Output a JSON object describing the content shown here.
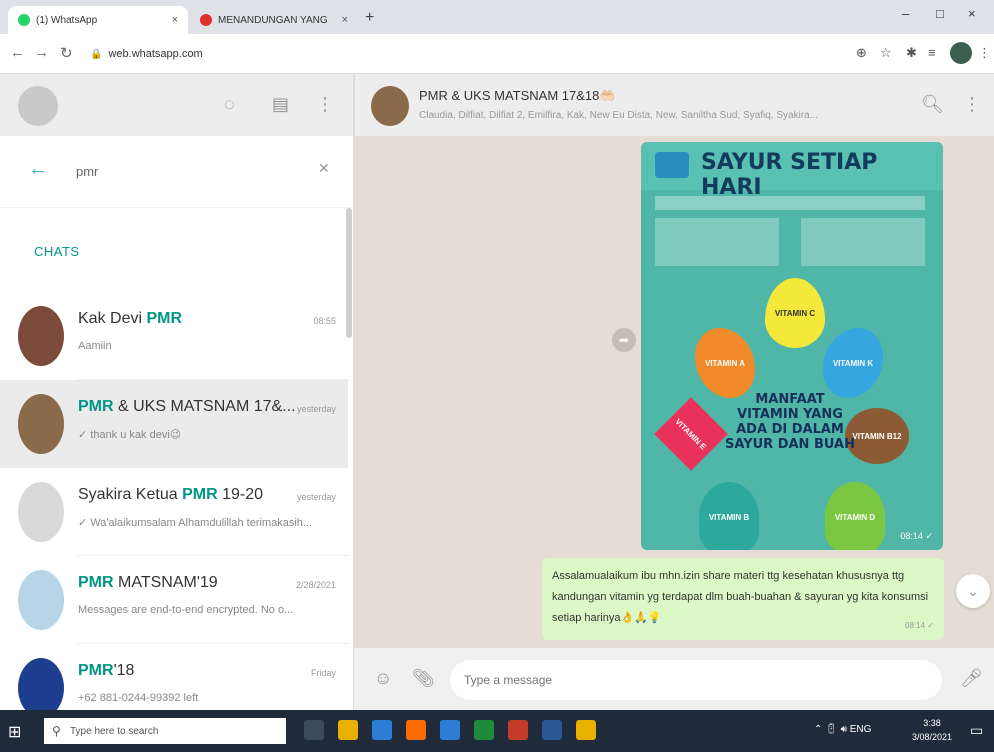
{
  "browser": {
    "tabs": [
      {
        "title": "(1) WhatsApp",
        "favicon_color": "#25d366",
        "active": true
      },
      {
        "title": "MENANDUNGAN YANG",
        "favicon_color": "#e0302a",
        "active": false
      }
    ],
    "url": "web.whatsapp.com",
    "window_controls": [
      "–",
      "□",
      "×"
    ]
  },
  "sidebar": {
    "search_value": "pmr",
    "section_label": "CHATS",
    "chats": [
      {
        "name_prefix": "Kak Devi ",
        "name_highlight": "PMR",
        "name_suffix": "",
        "time": "08:55",
        "message": "Aamiin",
        "avatar_color": "#7b4a3a",
        "selected": false
      },
      {
        "name_prefix": "",
        "name_highlight": "PMR",
        "name_suffix": " & UKS MATSNAM 17&...",
        "time": "yesterday",
        "message": "✓ thank u kak devi😉",
        "avatar_color": "#8a6a4a",
        "selected": true
      },
      {
        "name_prefix": "Syakira Ketua ",
        "name_highlight": "PMR",
        "name_suffix": " 19-20",
        "time": "yesterday",
        "message": "✓ Wa'alaikumsalam Alhamdulillah terimakasih...",
        "avatar_color": "#d9d9d9",
        "selected": false
      },
      {
        "name_prefix": "",
        "name_highlight": "PMR",
        "name_suffix": " MATSNAM'19",
        "time": "2/28/2021",
        "message": "Messages are end-to-end encrypted. No o...",
        "avatar_color": "#b8d4e8",
        "selected": false
      },
      {
        "name_prefix": "",
        "name_highlight": "PMR",
        "name_suffix": "'18",
        "time": "Friday",
        "message": "+62 881-0244-99392 left",
        "avatar_color": "#1e3f8f",
        "selected": false
      }
    ]
  },
  "conversation": {
    "title": "PMR & UKS MATSNAM 17&18🤲🏻",
    "members": "Claudia, Dilfiat, Dilfiat 2, Emilfira, Kak, New Eu Dista, New, Saniltha Sud, Syafiq, Syakira...",
    "image_message": {
      "title": "SAYUR SETIAP HARI",
      "center_text": "MANFAAT VITAMIN YANG ADA DI DALAM SAYUR DAN BUAH",
      "petals": [
        "VITAMIN C",
        "VITAMIN A",
        "VITAMIN K",
        "VITAMIN E",
        "VITAMIN B12",
        "VITAMIN B",
        "VITAMIN D"
      ],
      "time": "08:14 ✓"
    },
    "text_message": {
      "text": "Assalamualaikum ibu mhn.izin share materi ttg kesehatan khususnya ttg kandungan vitamin yg terdapat dlm buah-buahan & sayuran yg kita konsumsi setiap harinya👌🙏💡",
      "time": "08:14 ✓"
    },
    "composer_placeholder": "Type a message"
  },
  "taskbar": {
    "search_placeholder": "Type here to search",
    "time": "3:38",
    "date": "3/08/2021",
    "app_colors": [
      "#e8b000",
      "#2d7cd6",
      "#ff6a00",
      "#2d7cd6",
      "#1e8a3a",
      "#c43b2a",
      "#2b5797",
      "#e8b000"
    ]
  }
}
